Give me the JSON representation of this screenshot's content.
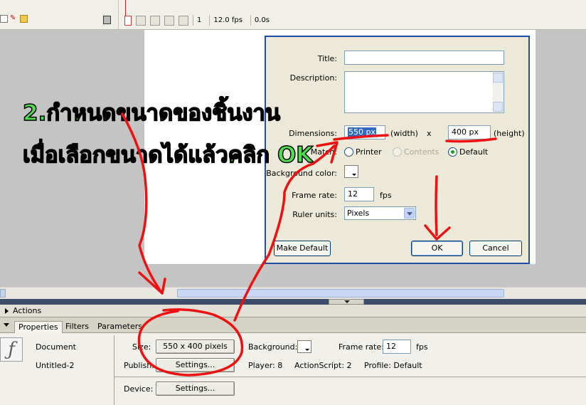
{
  "timeline": {
    "frame_number": "1",
    "fps": "12.0 fps",
    "elapsed": "0.0s"
  },
  "dialog": {
    "title_label": "Title:",
    "title_value": "",
    "description_label": "Description:",
    "description_value": "",
    "dimensions_label": "Dimensions:",
    "width_value": "550 px",
    "width_suffix": "(width)",
    "times": "x",
    "height_value": "400 px",
    "height_suffix": "(height)",
    "match_label": "Match:",
    "match_options": [
      "Printer",
      "Contents",
      "Default"
    ],
    "match_selected": "Default",
    "bg_color_label": "Background color:",
    "frame_rate_label": "Frame rate:",
    "frame_rate_value": "12",
    "fps_unit": "fps",
    "ruler_units_label": "Ruler units:",
    "ruler_units_value": "Pixels",
    "make_default_label": "Make Default",
    "ok_label": "OK",
    "cancel_label": "Cancel"
  },
  "panels": {
    "actions_label": "Actions",
    "tabs": [
      "Properties",
      "Filters",
      "Parameters"
    ],
    "active_tab": "Properties"
  },
  "properties": {
    "doc_type": "Document",
    "doc_name": "Untitled-2",
    "size_label": "Size:",
    "size_button": "550 x 400 pixels",
    "background_label": "Background:",
    "frame_rate_label": "Frame rate:",
    "frame_rate_value": "12",
    "fps_unit": "fps",
    "publish_label": "Publish:",
    "settings_label": "Settings...",
    "player_label": "Player: 8",
    "actionscript_label": "ActionScript: 2",
    "profile_label": "Profile: Default",
    "device_label": "Device:",
    "device_settings_label": "Settings..."
  },
  "annotation": {
    "line1": "2.กำหนดขนาดของชิ้นงาน",
    "line2": "เมื่อเลือกขนาดได้แล้วคลิก OK",
    "color": "#4be04b",
    "pen_color": "#ee1111"
  }
}
